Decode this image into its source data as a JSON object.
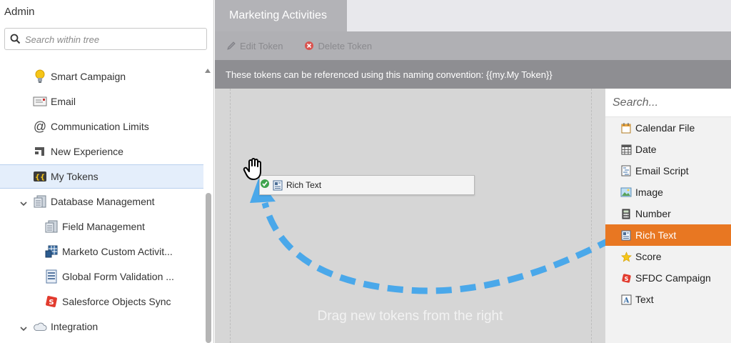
{
  "sidebar": {
    "title": "Admin",
    "search_placeholder": "Search within tree",
    "items": [
      {
        "label": "Smart Campaign",
        "icon": "lightbulb-icon"
      },
      {
        "label": "Email",
        "icon": "email-icon"
      },
      {
        "label": "Communication Limits",
        "icon": "at-sign-icon"
      },
      {
        "label": "New Experience",
        "icon": "new-experience-icon"
      },
      {
        "label": "My Tokens",
        "icon": "tokens-icon",
        "selected": true
      },
      {
        "label": "Database Management",
        "icon": "database-icon",
        "expanded": true
      },
      {
        "label": "Field Management",
        "icon": "database-icon"
      },
      {
        "label": "Marketo Custom Activit...",
        "icon": "custom-activity-icon"
      },
      {
        "label": "Global Form Validation ...",
        "icon": "form-validation-icon"
      },
      {
        "label": "Salesforce Objects Sync",
        "icon": "salesforce-sync-icon"
      },
      {
        "label": "Integration",
        "icon": "cloud-icon",
        "expanded": true
      }
    ]
  },
  "main": {
    "tab_label": "Marketing Activities",
    "toolbar": {
      "edit_label": "Edit Token",
      "delete_label": "Delete Token"
    },
    "info_text": "These tokens can be referenced using this naming convention: {{my.My Token}}",
    "canvas": {
      "dragged_token_label": "Rich Text",
      "hint": "Drag new tokens from the right"
    }
  },
  "palette": {
    "search_placeholder": "Search...",
    "items": [
      {
        "label": "Calendar File",
        "icon": "calendar-file-icon"
      },
      {
        "label": "Date",
        "icon": "date-icon"
      },
      {
        "label": "Email Script",
        "icon": "email-script-icon"
      },
      {
        "label": "Image",
        "icon": "image-icon"
      },
      {
        "label": "Number",
        "icon": "number-icon"
      },
      {
        "label": "Rich Text",
        "icon": "rich-text-icon",
        "active": true
      },
      {
        "label": "Score",
        "icon": "star-icon"
      },
      {
        "label": "SFDC Campaign",
        "icon": "sfdc-campaign-icon"
      },
      {
        "label": "Text",
        "icon": "text-icon"
      }
    ]
  },
  "colors": {
    "accent_orange": "#e87722",
    "arrow_blue": "#4aa8ea",
    "selected_row": "#e4eefb"
  }
}
